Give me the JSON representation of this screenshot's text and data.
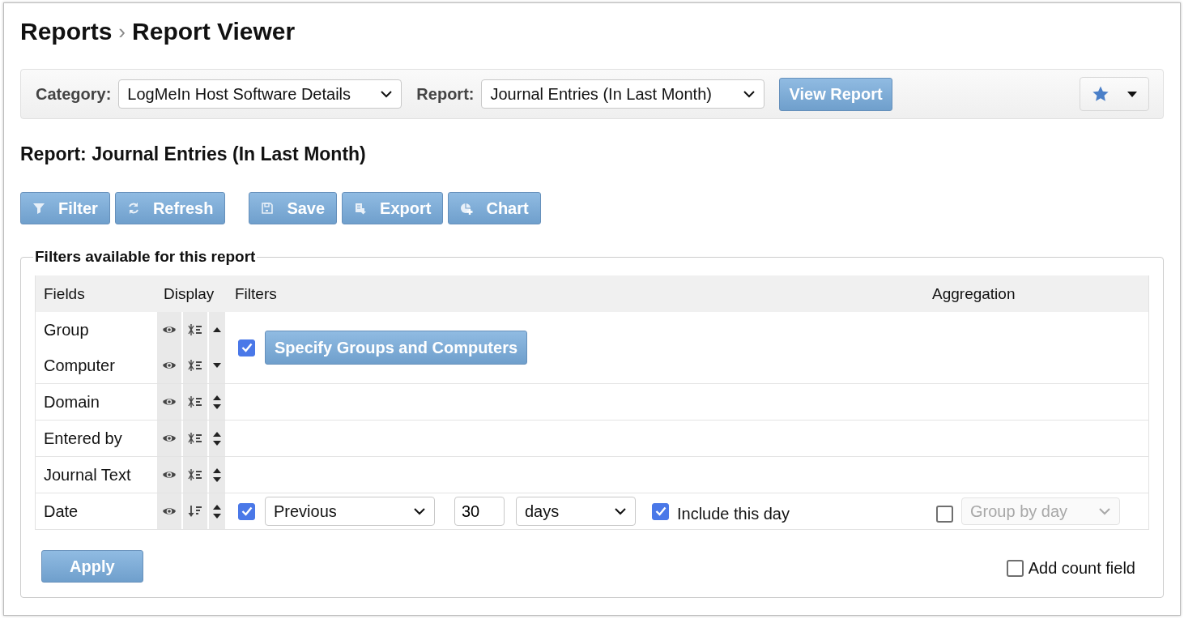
{
  "breadcrumb": {
    "items": [
      "Reports",
      "Report Viewer"
    ],
    "separator": "›"
  },
  "toolbar": {
    "category": {
      "label": "Category:",
      "value": "LogMeIn Host Software Details"
    },
    "report": {
      "label": "Report:",
      "value": "Journal Entries (In Last Month)"
    },
    "view_button": "View Report"
  },
  "report_title": "Report: Journal Entries (In Last Month)",
  "action_groups": [
    [
      {
        "kind": "filter",
        "label": "Filter"
      },
      {
        "kind": "refresh",
        "label": "Refresh"
      }
    ],
    [
      {
        "kind": "save",
        "label": "Save"
      },
      {
        "kind": "export",
        "label": "Export"
      },
      {
        "kind": "chart",
        "label": "Chart"
      }
    ]
  ],
  "filters_panel": {
    "legend": "Filters available for this report",
    "columns": [
      "Fields",
      "Display",
      "Filters",
      "Aggregation"
    ],
    "groups": [
      {
        "fields": [
          {
            "name": "Group",
            "sorted_descending": false,
            "move_up": true,
            "move_down": false
          },
          {
            "name": "Computer",
            "sorted_descending": false,
            "move_up": false,
            "move_down": true
          }
        ],
        "filter": {
          "kind": "button",
          "checked": true,
          "label": "Specify Groups and Computers"
        }
      },
      {
        "fields": [
          {
            "name": "Domain",
            "sorted_descending": false,
            "move_up": true,
            "move_down": true
          }
        ]
      },
      {
        "fields": [
          {
            "name": "Entered by",
            "sorted_descending": false,
            "move_up": true,
            "move_down": true
          }
        ]
      },
      {
        "fields": [
          {
            "name": "Journal Text",
            "sorted_descending": false,
            "move_up": true,
            "move_down": true
          }
        ]
      },
      {
        "fields": [
          {
            "name": "Date",
            "sorted_descending": true,
            "move_up": true,
            "move_down": true
          }
        ],
        "filter": {
          "kind": "date",
          "checked": true,
          "mode": "Previous",
          "count": "30",
          "unit": "days",
          "include_checked": true,
          "include_label": "Include this day"
        },
        "aggregation": {
          "checked": false,
          "value": "Group by day",
          "disabled": true
        }
      }
    ],
    "apply_button": "Apply",
    "add_count": {
      "label": "Add count field",
      "checked": false
    }
  }
}
